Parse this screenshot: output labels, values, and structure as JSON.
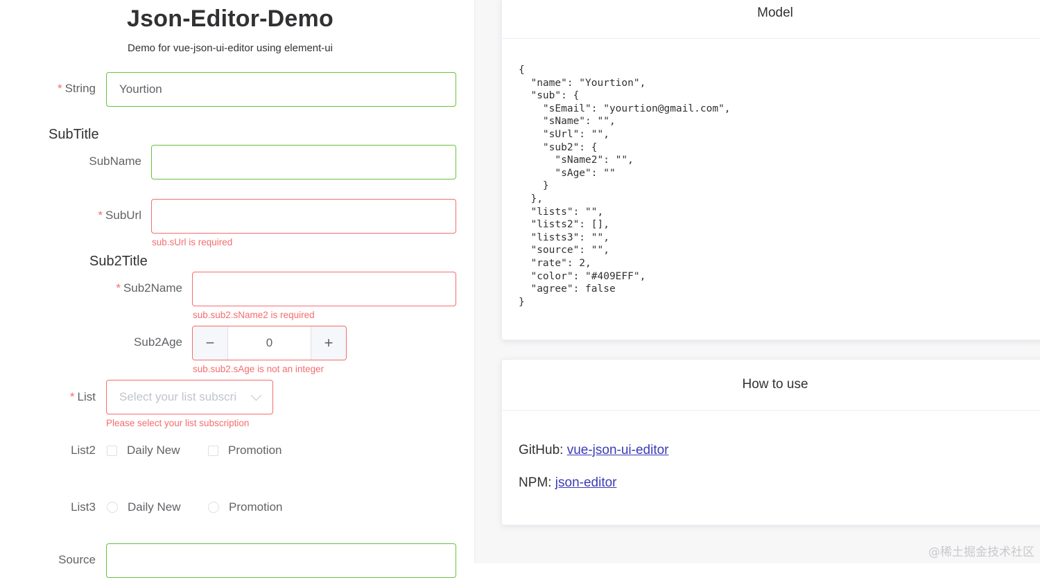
{
  "header": {
    "title": "Json-Editor-Demo",
    "subtitle": "Demo for vue-json-ui-editor using element-ui"
  },
  "form": {
    "required_mark": "*",
    "string": {
      "label": "String",
      "value": "Yourtion"
    },
    "subtitle_section": "SubTitle",
    "subname": {
      "label": "SubName",
      "value": ""
    },
    "suburl": {
      "label": "SubUrl",
      "value": "",
      "error": "sub.sUrl is required"
    },
    "sub2title_section": "Sub2Title",
    "sub2name": {
      "label": "Sub2Name",
      "value": "",
      "error": "sub.sub2.sName2 is required"
    },
    "sub2age": {
      "label": "Sub2Age",
      "value": "0",
      "minus": "−",
      "plus": "+",
      "error": "sub.sub2.sAge is not an integer"
    },
    "list": {
      "label": "List",
      "placeholder": "Select your list subscri",
      "error": "Please select your list subscription"
    },
    "list2": {
      "label": "List2",
      "options": [
        "Daily New",
        "Promotion"
      ]
    },
    "list3": {
      "label": "List3",
      "options": [
        "Daily New",
        "Promotion"
      ]
    },
    "source": {
      "label": "Source",
      "value": ""
    }
  },
  "model_card": {
    "title": "Model",
    "json_text": "{\n  \"name\": \"Yourtion\",\n  \"sub\": {\n    \"sEmail\": \"yourtion@gmail.com\",\n    \"sName\": \"\",\n    \"sUrl\": \"\",\n    \"sub2\": {\n      \"sName2\": \"\",\n      \"sAge\": \"\"\n    }\n  },\n  \"lists\": \"\",\n  \"lists2\": [],\n  \"lists3\": \"\",\n  \"source\": \"\",\n  \"rate\": 2,\n  \"color\": \"#409EFF\",\n  \"agree\": false\n}"
  },
  "howto_card": {
    "title": "How to use",
    "github_label": "GitHub:",
    "github_link": "vue-json-ui-editor",
    "npm_label": "NPM:",
    "npm_link": "json-editor"
  },
  "watermark": "@稀土掘金技术社区",
  "colors": {
    "valid_border": "#67c23a",
    "error": "#f56c6c",
    "link": "#3a3ab8"
  }
}
